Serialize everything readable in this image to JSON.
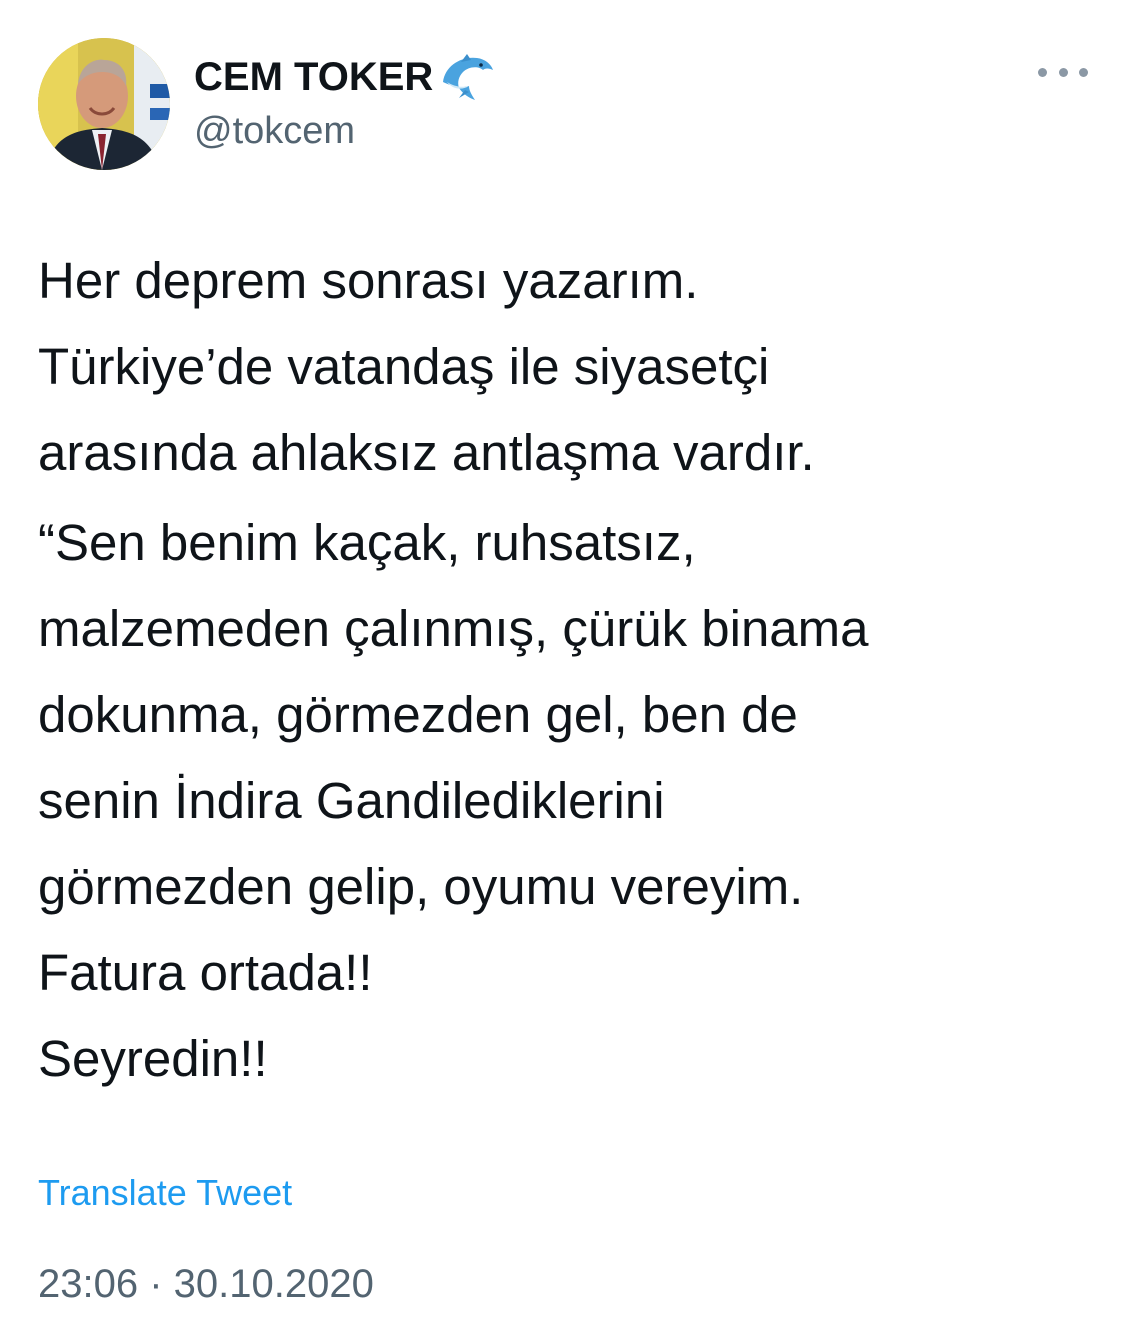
{
  "author": {
    "display_name": "CEM TOKER",
    "handle": "@tokcem",
    "name_emoji_icon": "dolphin-icon"
  },
  "tweet": {
    "paragraph_1": "Her deprem sonrası yazarım.\nTürkiye’de vatandaş ile siyasetçi\narasında ahlaksız antlaşma vardır.",
    "paragraph_2": "“Sen benim kaçak, ruhsatsız,\nmalzemeden çalınmış, çürük binama\ndokunma, görmezden gel, ben de\nsenin İndira Gandilediklerini\ngörmezden gelip, oyumu vereyim.\nFatura ortada!!\nSeyredin!!"
  },
  "translate_label": "Translate Tweet",
  "timestamp": "23:06 · 30.10.2020",
  "colors": {
    "link": "#1d9bf0",
    "muted": "#536471",
    "text": "#0f1419"
  }
}
